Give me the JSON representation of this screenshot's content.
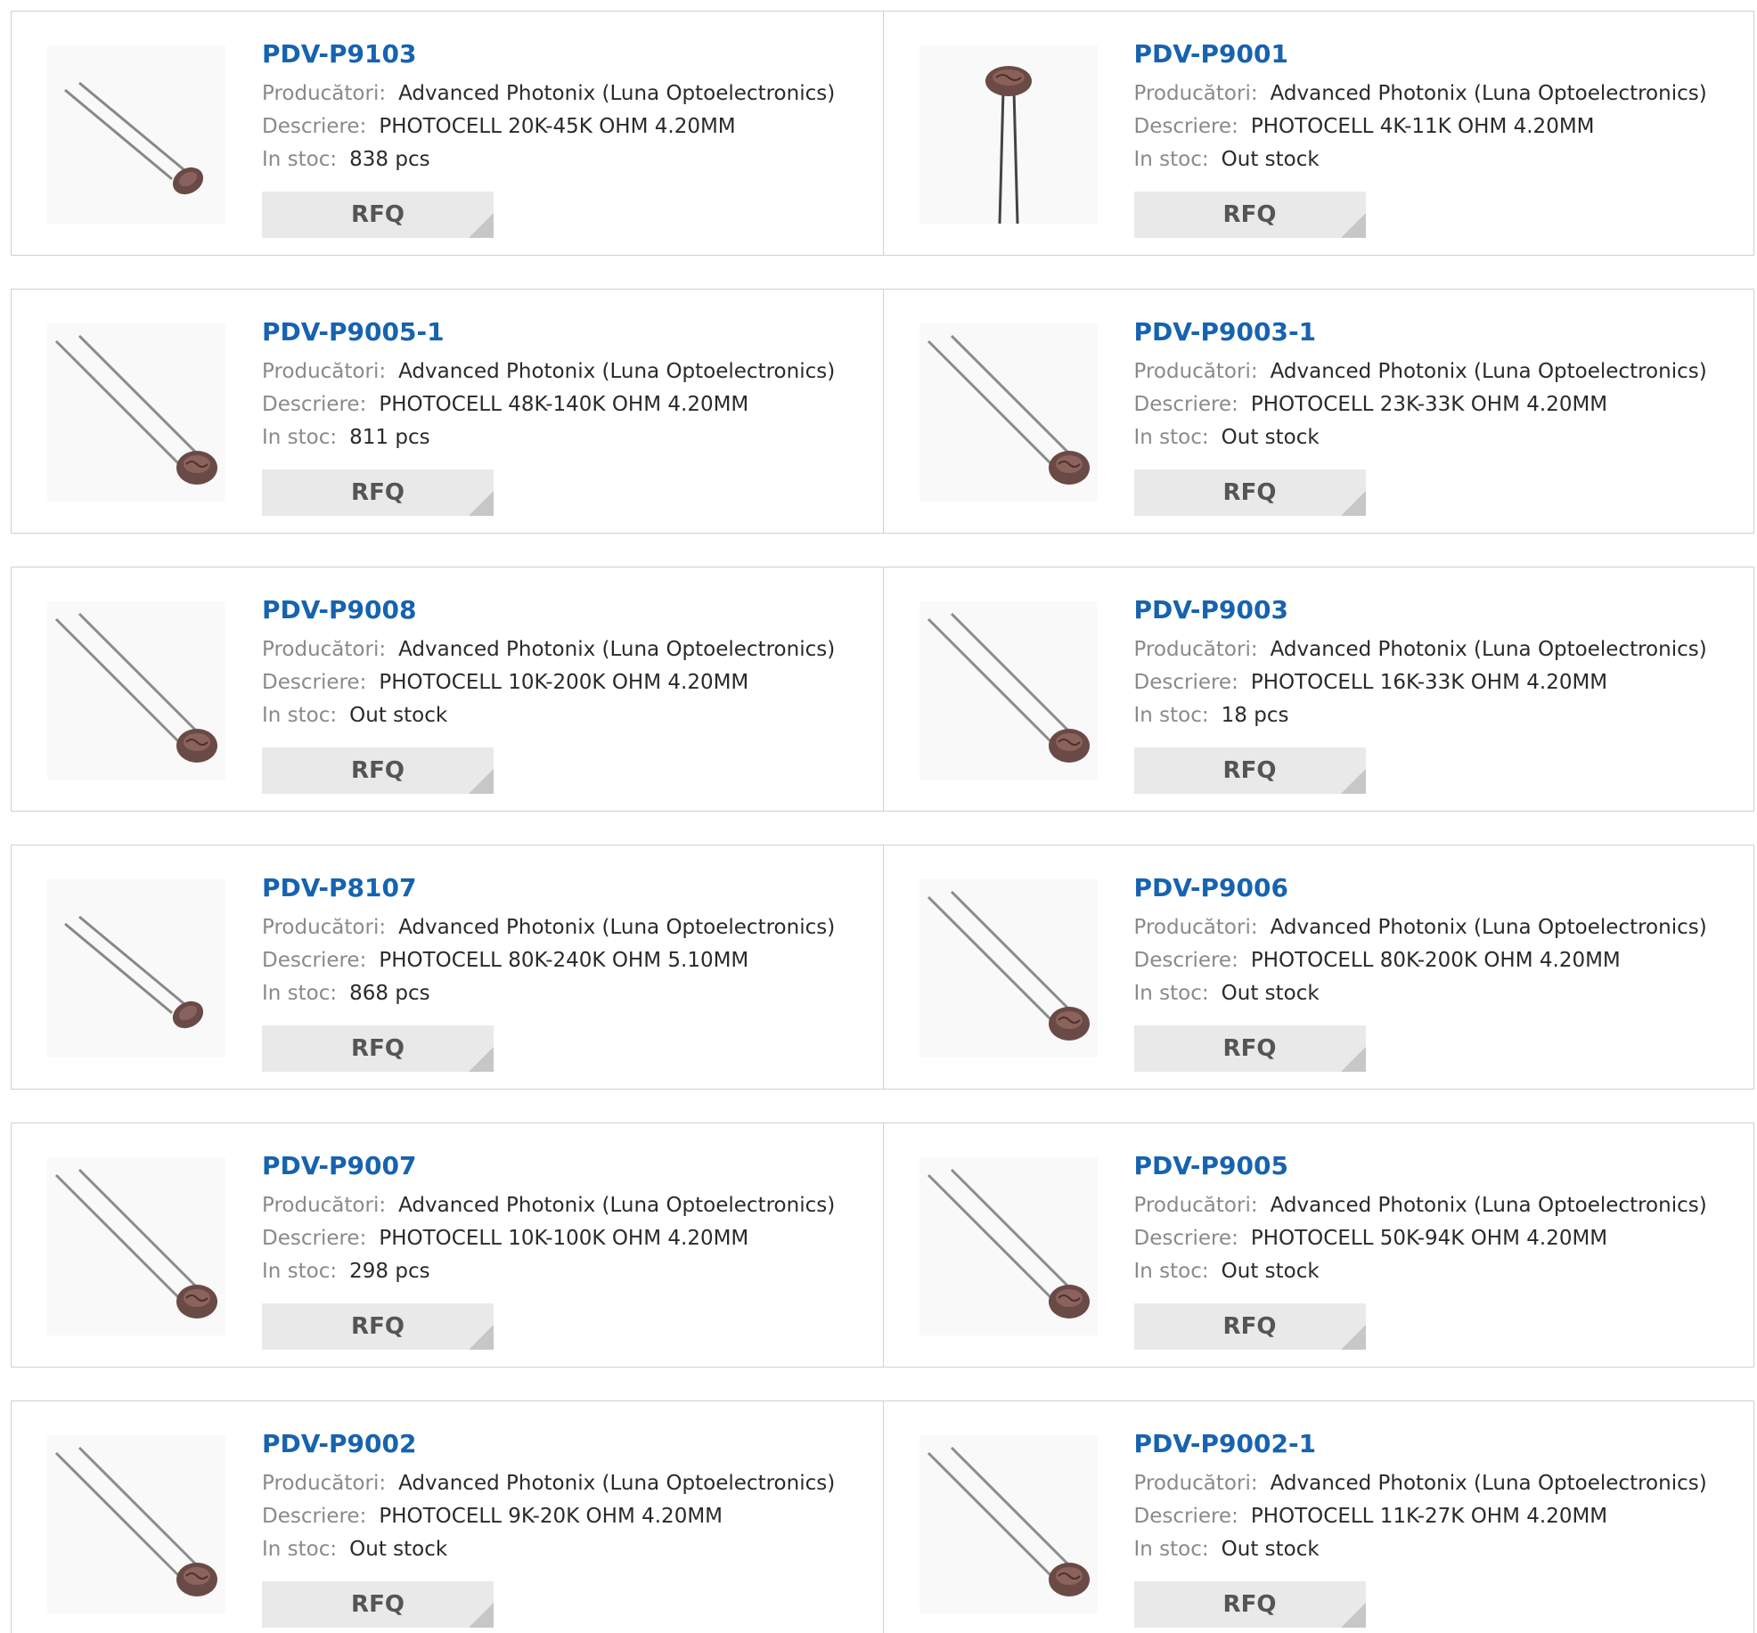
{
  "labels": {
    "manufacturer": "Producători:",
    "description": "Descriere:",
    "stock": "In stoc:",
    "rfq": "RFQ"
  },
  "colors": {
    "part_link": "#1663b0",
    "label": "#8a8a8a",
    "value": "#2a2a2a",
    "rfq_bg": "#e9e9e9",
    "rfq_text": "#555555",
    "border": "#d0d0d0"
  },
  "products": [
    {
      "part": "PDV-P9103",
      "manufacturer": "Advanced Photonix (Luna Optoelectronics)",
      "description": "PHOTOCELL 20K-45K OHM 4.20MM",
      "stock": "838 pcs",
      "image": "photocell-small-icon"
    },
    {
      "part": "PDV-P9001",
      "manufacturer": "Advanced Photonix (Luna Optoelectronics)",
      "description": "PHOTOCELL 4K-11K OHM 4.20MM",
      "stock": "Out stock",
      "image": "photocell-vertical-icon"
    },
    {
      "part": "PDV-P9005-1",
      "manufacturer": "Advanced Photonix (Luna Optoelectronics)",
      "description": "PHOTOCELL 48K-140K OHM 4.20MM",
      "stock": "811 pcs",
      "image": "photocell-icon"
    },
    {
      "part": "PDV-P9003-1",
      "manufacturer": "Advanced Photonix (Luna Optoelectronics)",
      "description": "PHOTOCELL 23K-33K OHM 4.20MM",
      "stock": "Out stock",
      "image": "photocell-icon"
    },
    {
      "part": "PDV-P9008",
      "manufacturer": "Advanced Photonix (Luna Optoelectronics)",
      "description": "PHOTOCELL 10K-200K OHM 4.20MM",
      "stock": "Out stock",
      "image": "photocell-icon"
    },
    {
      "part": "PDV-P9003",
      "manufacturer": "Advanced Photonix (Luna Optoelectronics)",
      "description": "PHOTOCELL 16K-33K OHM 4.20MM",
      "stock": "18 pcs",
      "image": "photocell-icon"
    },
    {
      "part": "PDV-P8107",
      "manufacturer": "Advanced Photonix (Luna Optoelectronics)",
      "description": "PHOTOCELL 80K-240K OHM 5.10MM",
      "stock": "868 pcs",
      "image": "photocell-small-icon"
    },
    {
      "part": "PDV-P9006",
      "manufacturer": "Advanced Photonix (Luna Optoelectronics)",
      "description": "PHOTOCELL 80K-200K OHM 4.20MM",
      "stock": "Out stock",
      "image": "photocell-icon"
    },
    {
      "part": "PDV-P9007",
      "manufacturer": "Advanced Photonix (Luna Optoelectronics)",
      "description": "PHOTOCELL 10K-100K OHM 4.20MM",
      "stock": "298 pcs",
      "image": "photocell-icon"
    },
    {
      "part": "PDV-P9005",
      "manufacturer": "Advanced Photonix (Luna Optoelectronics)",
      "description": "PHOTOCELL 50K-94K OHM 4.20MM",
      "stock": "Out stock",
      "image": "photocell-icon"
    },
    {
      "part": "PDV-P9002",
      "manufacturer": "Advanced Photonix (Luna Optoelectronics)",
      "description": "PHOTOCELL 9K-20K OHM 4.20MM",
      "stock": "Out stock",
      "image": "photocell-icon"
    },
    {
      "part": "PDV-P9002-1",
      "manufacturer": "Advanced Photonix (Luna Optoelectronics)",
      "description": "PHOTOCELL 11K-27K OHM 4.20MM",
      "stock": "Out stock",
      "image": "photocell-icon"
    }
  ]
}
